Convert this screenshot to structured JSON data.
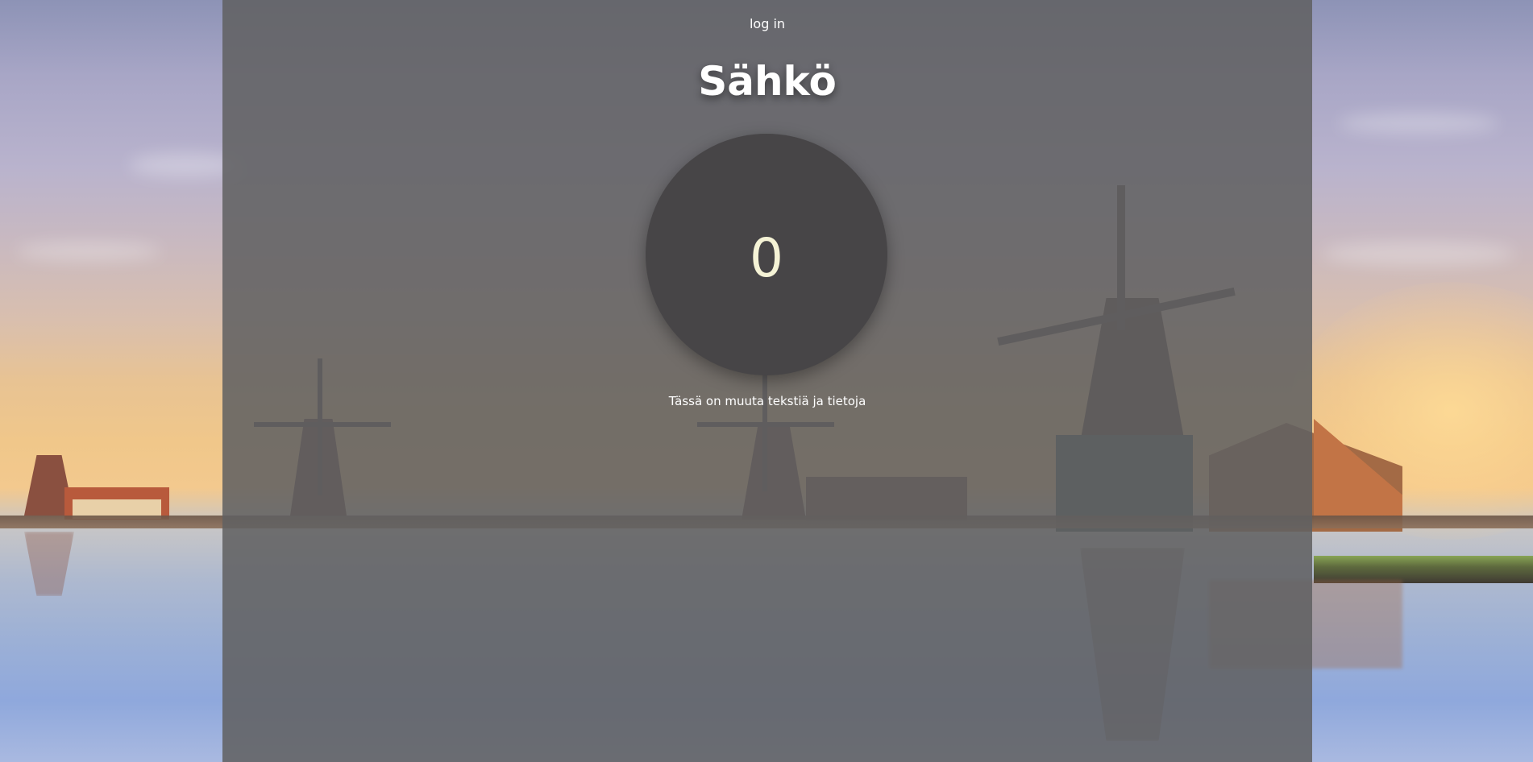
{
  "nav": {
    "login_label": "log in"
  },
  "header": {
    "title": "Sähkö"
  },
  "counter": {
    "value": "0"
  },
  "info": {
    "text": "Tässä on muuta tekstiä ja tietoja"
  },
  "colors": {
    "panel_overlay": "#606062",
    "circle_background": "#474547",
    "counter_text": "#f5f3d6",
    "text": "#ffffff"
  }
}
